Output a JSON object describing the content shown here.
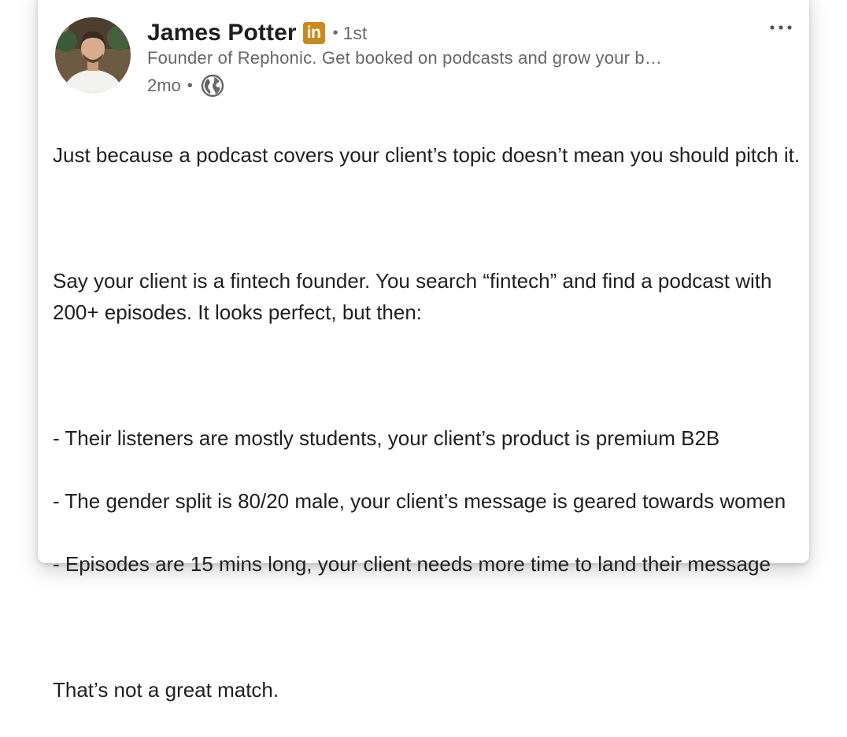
{
  "post": {
    "author": {
      "name": "James Potter",
      "badge": "in",
      "connection_separator": "•",
      "connection_degree": "1st",
      "headline": "Founder of Rephonic. Get booked on podcasts and grow your b…"
    },
    "meta": {
      "timestamp": "2mo",
      "separator": "•",
      "visibility_icon": "globe-icon"
    },
    "more_icon": "more-horizontal-icon",
    "colors": {
      "badge_bg": "#c8891d",
      "text_primary": "#1f1f1f",
      "text_secondary": "#666666"
    },
    "paragraphs": [
      "Just because a podcast covers your client’s topic doesn’t mean you should pitch it.",
      "",
      "Say your client is a fintech founder. You search “fintech” and find a podcast with 200+ episodes. It looks perfect, but then:",
      "",
      "- Their listeners are mostly students, your client’s product is premium B2B",
      "- The gender split is 80/20 male, your client’s message is geared towards women",
      "- Episodes are 15 mins long, your client needs more time to land their message",
      "",
      "That’s not a great match."
    ]
  }
}
